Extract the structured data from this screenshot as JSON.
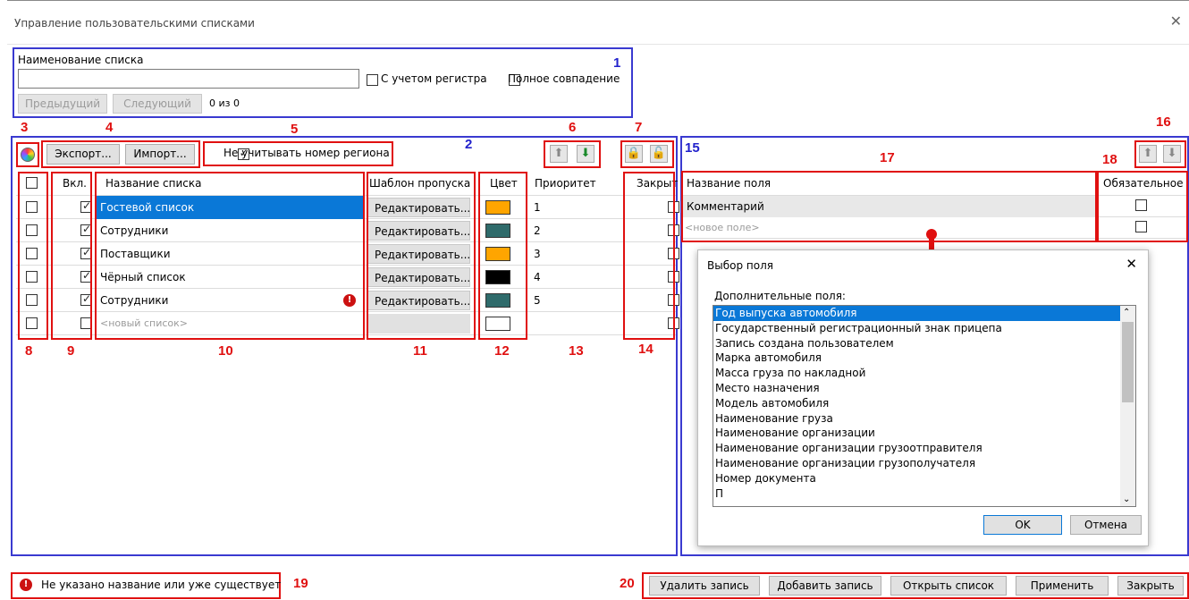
{
  "window": {
    "title": "Управление пользовательскими списками",
    "close_glyph": "✕"
  },
  "search": {
    "label": "Наименование списка",
    "value": "",
    "case_label": "С учетом регистра",
    "exact_label": "Полное совпадение",
    "prev_label": "Предыдущий",
    "next_label": "Следующий",
    "counter": "0 из 0"
  },
  "toolbar": {
    "export_label": "Экспорт...",
    "import_label": "Импорт...",
    "ignore_region_label": "Не учитывать номер региона"
  },
  "table": {
    "headers": {
      "enabled": "Вкл.",
      "name": "Название списка",
      "template": "Шаблон пропуска",
      "color": "Цвет",
      "priority": "Приоритет",
      "closed": "Закрыт"
    },
    "edit_label": "Редактировать...",
    "rows": [
      {
        "name": "Гостевой список",
        "color": "#ffa500",
        "priority": "1",
        "enabled": true,
        "closed": false,
        "selected": true,
        "error": false
      },
      {
        "name": "Сотрудники",
        "color": "#2f6b6b",
        "priority": "2",
        "enabled": true,
        "closed": false,
        "selected": false,
        "error": false
      },
      {
        "name": "Поставщики",
        "color": "#ffa500",
        "priority": "3",
        "enabled": true,
        "closed": false,
        "selected": false,
        "error": false
      },
      {
        "name": "Чёрный список",
        "color": "#000000",
        "priority": "4",
        "enabled": true,
        "closed": false,
        "selected": false,
        "error": false
      },
      {
        "name": "Сотрудники",
        "color": "#2f6b6b",
        "priority": "5",
        "enabled": true,
        "closed": false,
        "selected": false,
        "error": true
      }
    ],
    "new_row_placeholder": "<новый список>"
  },
  "fields": {
    "headers": {
      "name": "Название поля",
      "required": "Обязательное"
    },
    "rows": [
      {
        "name": "Комментарий",
        "required": false
      }
    ],
    "new_row_placeholder": "<новое поле>"
  },
  "picker": {
    "title": "Выбор поля",
    "close_glyph": "✕",
    "list_label": "Дополнительные поля:",
    "items": [
      "Год выпуска автомобиля",
      "Государственный регистрационный знак прицепа",
      "Запись создана пользователем",
      "Марка автомобиля",
      "Масса груза по накладной",
      "Место назначения",
      "Модель автомобиля",
      "Наименование груза",
      "Наименование организации",
      "Наименование организации грузоотправителя",
      "Наименование организации грузополучателя",
      "Номер документа",
      "П"
    ],
    "selected_index": 0,
    "ok_label": "OK",
    "cancel_label": "Отмена"
  },
  "status": {
    "message": "Не указано название или уже существует"
  },
  "footer": {
    "delete_label": "Удалить запись",
    "add_label": "Добавить запись",
    "open_label": "Открыть список",
    "apply_label": "Применить",
    "close_label": "Закрыть"
  },
  "callouts": {
    "n1": "1",
    "n2": "2",
    "n3": "3",
    "n4": "4",
    "n5": "5",
    "n6": "6",
    "n7": "7",
    "n8": "8",
    "n9": "9",
    "n10": "10",
    "n11": "11",
    "n12": "12",
    "n13": "13",
    "n14": "14",
    "n15": "15",
    "n16": "16",
    "n17": "17",
    "n18": "18",
    "n19": "19",
    "n20": "20"
  },
  "colors": {
    "callout_red": "#e01010",
    "callout_blue": "#3a3ad0",
    "selection": "#0a78d7",
    "error": "#cc1111"
  }
}
